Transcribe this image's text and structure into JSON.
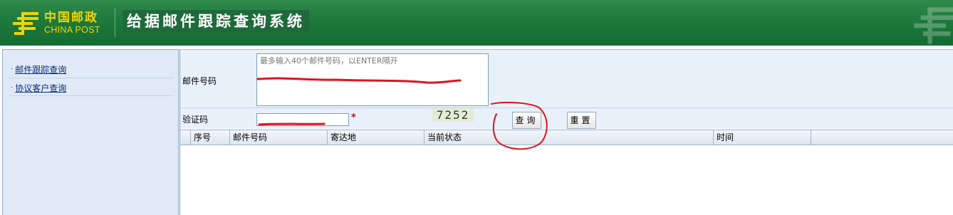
{
  "header": {
    "logo_cn": "中国邮政",
    "logo_en": "CHINA POST",
    "system_title": "给据邮件跟踪查询系统"
  },
  "sidebar": {
    "items": [
      {
        "bullet": "·",
        "label": "邮件跟踪查询"
      },
      {
        "bullet": "·",
        "label": "协议客户查询"
      }
    ]
  },
  "form": {
    "tracking_label": "邮件号码",
    "tracking_placeholder": "最多输入40个邮件号码，以ENTER隔开",
    "captcha_label": "验证码",
    "captcha_value": "",
    "required_mark": "*",
    "captcha_code": "7252",
    "query_button": "查询",
    "reset_button": "重置"
  },
  "table": {
    "columns": [
      "序号",
      "邮件号码",
      "寄达地",
      "当前状态",
      "时间"
    ],
    "rows": []
  },
  "colors": {
    "header_green": "#1d7a3c",
    "logo_yellow": "#f2d400",
    "sidebar_bg": "#dfeaf6",
    "form_bg": "#e8f1fa",
    "annotation_red": "#e0141e"
  }
}
